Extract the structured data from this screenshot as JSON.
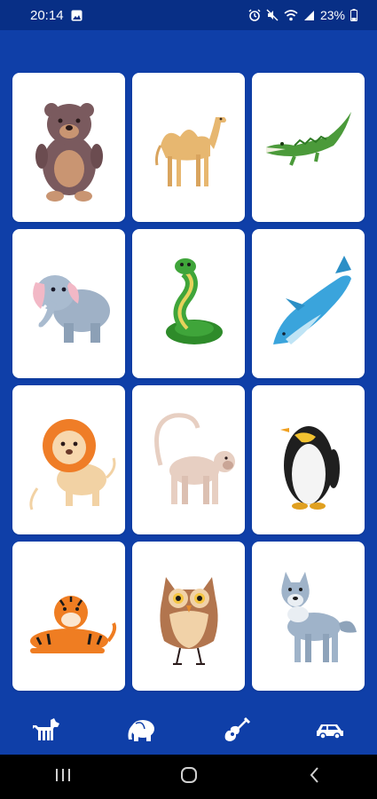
{
  "status_bar": {
    "time": "20:14",
    "battery": "23%"
  },
  "cards": [
    {
      "animal": "bear"
    },
    {
      "animal": "camel"
    },
    {
      "animal": "crocodile"
    },
    {
      "animal": "elephant"
    },
    {
      "animal": "snake"
    },
    {
      "animal": "dolphin"
    },
    {
      "animal": "lion"
    },
    {
      "animal": "monkey"
    },
    {
      "animal": "penguin"
    },
    {
      "animal": "tiger"
    },
    {
      "animal": "owl"
    },
    {
      "animal": "wolf"
    }
  ],
  "bottom_nav": {
    "items": [
      {
        "icon": "dog-icon"
      },
      {
        "icon": "elephant-icon"
      },
      {
        "icon": "guitar-icon"
      },
      {
        "icon": "car-icon"
      }
    ]
  },
  "colors": {
    "background": "#0f3fa8",
    "status_bar": "#082f86",
    "card": "#ffffff",
    "system_nav": "#000000"
  }
}
